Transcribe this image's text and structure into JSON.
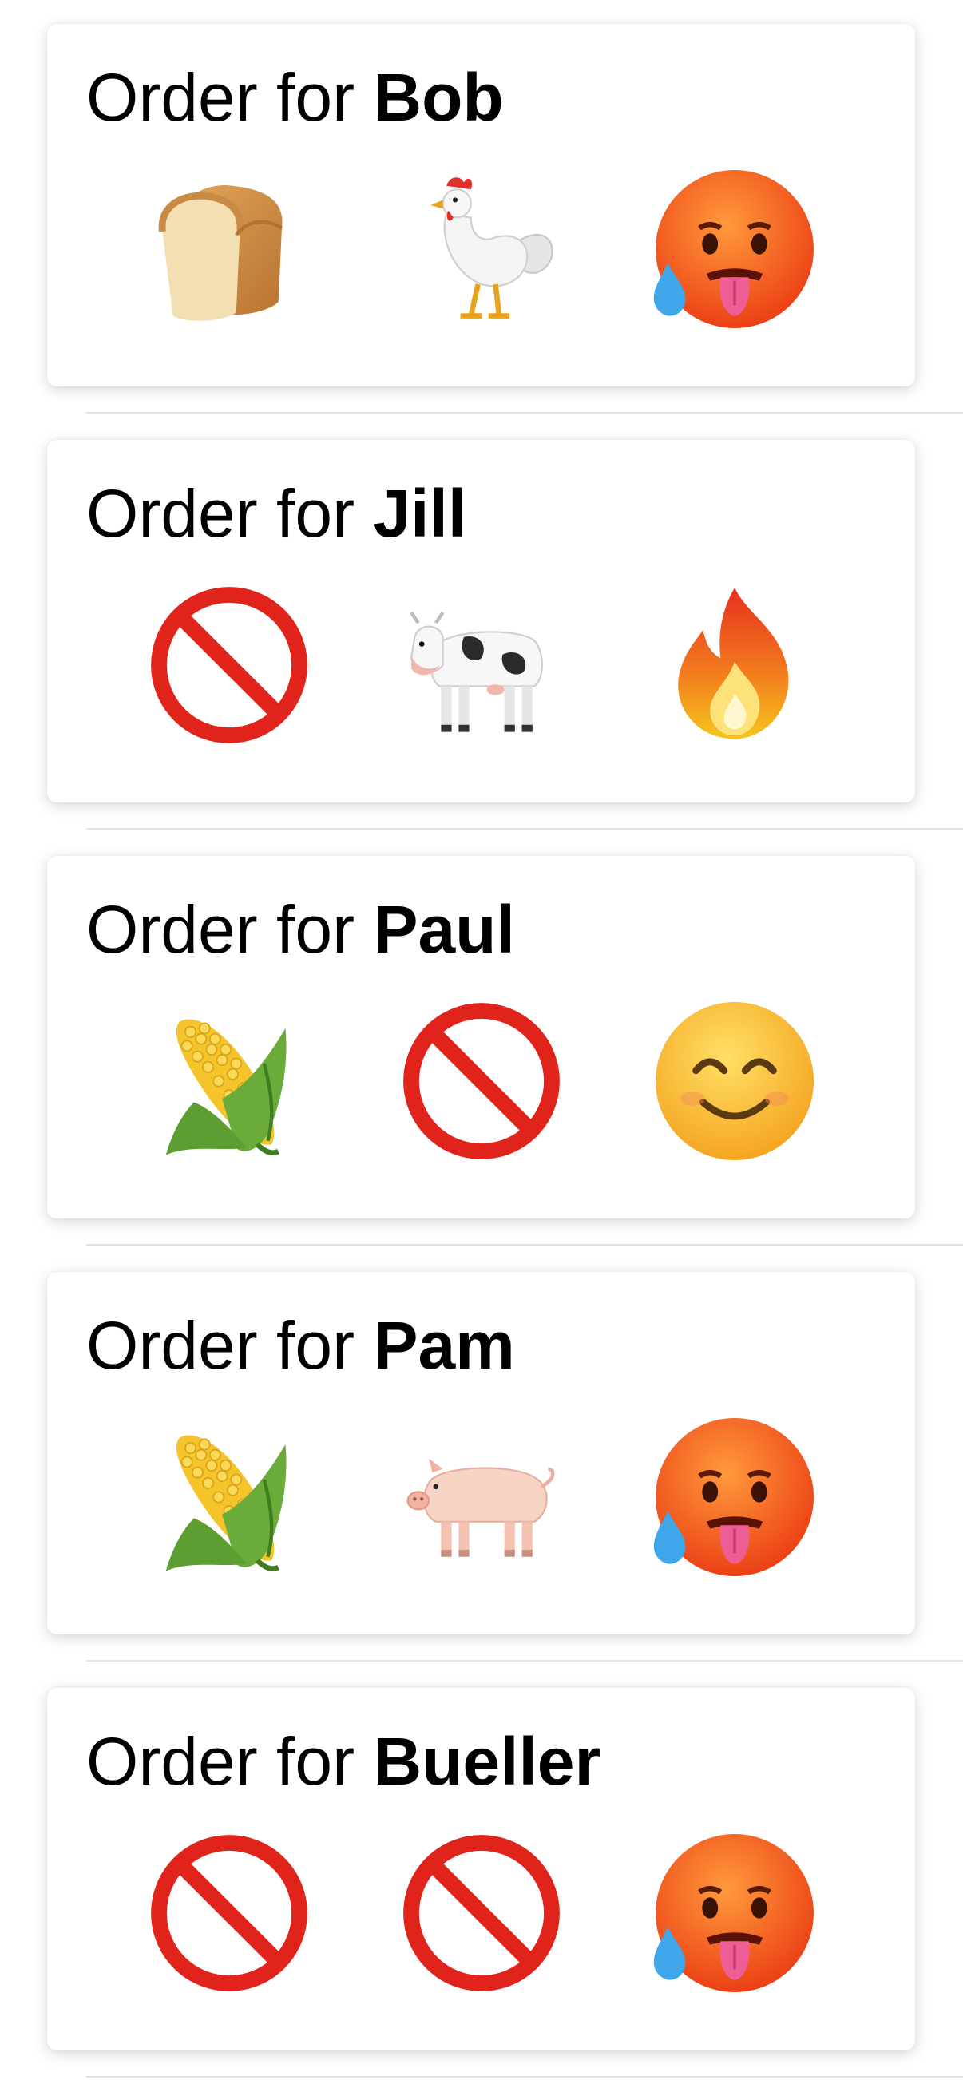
{
  "orders": [
    {
      "prefix": "Order for",
      "name": "Bob",
      "items": [
        "bread-icon",
        "rooster-icon",
        "hot-face-icon"
      ]
    },
    {
      "prefix": "Order for",
      "name": "Jill",
      "items": [
        "prohibited-icon",
        "cow-icon",
        "fire-icon"
      ]
    },
    {
      "prefix": "Order for",
      "name": "Paul",
      "items": [
        "corn-icon",
        "prohibited-icon",
        "smiling-face-icon"
      ]
    },
    {
      "prefix": "Order for",
      "name": "Pam",
      "items": [
        "corn-icon",
        "pig-icon",
        "hot-face-icon"
      ]
    },
    {
      "prefix": "Order for",
      "name": "Bueller",
      "items": [
        "prohibited-icon",
        "prohibited-icon",
        "hot-face-icon"
      ]
    }
  ]
}
